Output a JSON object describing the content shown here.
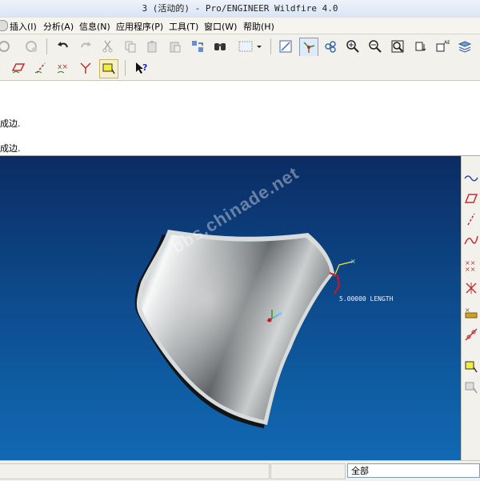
{
  "window": {
    "title": "3 (活动的) - Pro/ENGINEER Wildfire 4.0"
  },
  "menu": {
    "items": [
      "插入(I)",
      "分析(A)",
      "信息(N)",
      "应用程序(P)",
      "工具(T)",
      "窗口(W)",
      "帮助(H)"
    ]
  },
  "messages": [
    "成边.",
    "成边."
  ],
  "viewport": {
    "watermark": "bbs.chinade.net",
    "dimension_label": "5.00000 LENGTH"
  },
  "status": {
    "filter_value": "全部"
  },
  "colors": {
    "viewport_top": "#0b2c63",
    "viewport_bottom": "#1168b2",
    "part_surface": "#b9bcbd",
    "accent_yellow": "#f2ef3a",
    "accent_red": "#d8121a"
  },
  "icons": {
    "top_toolbar": [
      "regenerate",
      "undo",
      "redo",
      "cut",
      "copy",
      "paste",
      "paste-special",
      "replace",
      "find",
      "selection-box",
      "datum-display",
      "spin-center",
      "orient",
      "zoom-in",
      "zoom-out",
      "refit",
      "named-views",
      "layers",
      "model-tree"
    ],
    "second_toolbar": [
      "datum-plane",
      "datum-axis",
      "datum-point",
      "coordinate-system",
      "edge-select",
      "help-query"
    ],
    "right_toolbar": [
      "sketch",
      "datum-plane",
      "datum-axis",
      "curve",
      "datum-point",
      "datum-point-offset",
      "analysis",
      "coordinate-system",
      "edge-select",
      "select-filter"
    ]
  }
}
